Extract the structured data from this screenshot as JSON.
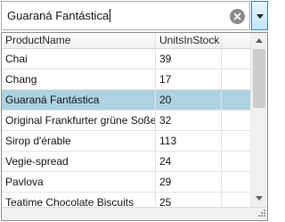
{
  "search": {
    "value": "Guaraná Fantástica"
  },
  "grid": {
    "columns": [
      "ProductName",
      "UnitsInStock"
    ],
    "rows": [
      {
        "name": "Chai",
        "stock": "39"
      },
      {
        "name": "Chang",
        "stock": "17"
      },
      {
        "name": "Guaraná Fantástica",
        "stock": "20"
      },
      {
        "name": "Original Frankfurter grüne Soße",
        "stock": "32"
      },
      {
        "name": "Sirop d'érable",
        "stock": "113"
      },
      {
        "name": "Vegie-spread",
        "stock": "24"
      },
      {
        "name": "Pavlova",
        "stock": "29"
      },
      {
        "name": "Teatime Chocolate Biscuits",
        "stock": "25"
      }
    ],
    "selected_index": 2
  },
  "icons": {
    "clear": "clear-circle-x-icon",
    "dropdown": "chevron-down-icon",
    "scroll_up": "scroll-up-arrow-icon",
    "scroll_down": "scroll-down-arrow-icon",
    "resize_grip": "resize-grip-icon"
  },
  "colors": {
    "selection": "#add3e3",
    "dropdown_border": "#3c7fb1",
    "clear_button": "#8a8a8a"
  }
}
